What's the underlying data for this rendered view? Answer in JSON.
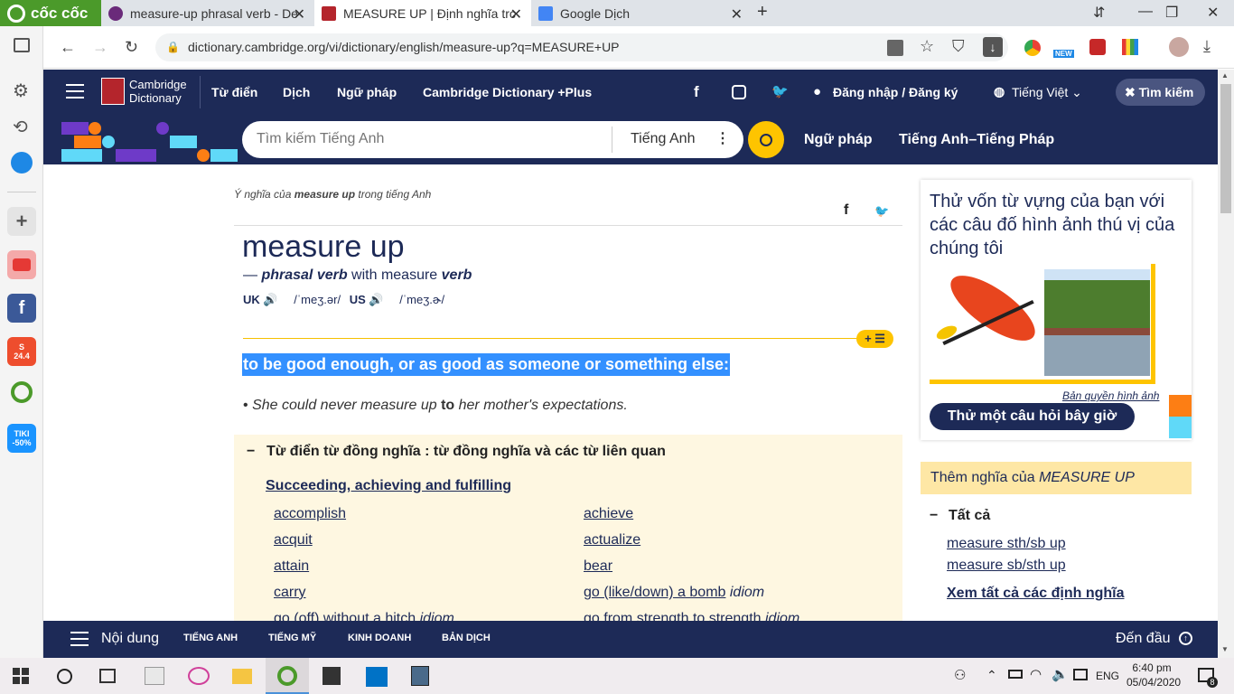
{
  "browser": {
    "brand": "cốc cốc",
    "tabs": [
      {
        "title": "measure-up phrasal verb - De",
        "icon_color": "#6a2a7a"
      },
      {
        "title": "MEASURE UP | Định nghĩa trc",
        "icon_color": "#b4252c"
      },
      {
        "title": "Google Dịch",
        "icon_color": "#4285f4"
      }
    ],
    "url": "dictionary.cambridge.org/vi/dictionary/english/measure-up?q=MEASURE+UP",
    "new_badge": "NEW"
  },
  "sidebar": {
    "icons": [
      "settings-icon",
      "history-icon",
      "messenger-icon",
      "add-icon",
      "youtube-icon",
      "facebook-icon",
      "shopee-icon",
      "coccoc-icon",
      "tiki-icon"
    ],
    "shopee_label": "24.4",
    "tiki_label": "TIKI -50%"
  },
  "header": {
    "logo_line1": "Cambridge",
    "logo_line2": "Dictionary",
    "nav": [
      "Từ điển",
      "Dịch",
      "Ngữ pháp",
      "Cambridge Dictionary +Plus"
    ],
    "login": "Đăng nhập / Đăng ký",
    "language": "Tiếng Việt",
    "search_toggle": "Tìm kiếm",
    "search_placeholder": "Tìm kiếm Tiếng Anh",
    "search_lang": "Tiếng Anh",
    "sub_nav": [
      "Ngữ pháp",
      "Tiếng Anh–Tiếng Pháp"
    ]
  },
  "entry": {
    "breadcrumb_pre": "Ý nghĩa của ",
    "breadcrumb_word": "measure up",
    "breadcrumb_post": " trong tiếng Anh",
    "headword": "measure up",
    "pos_dash": "— ",
    "pos": "phrasal verb",
    "with": " with measure ",
    "with_pos": "verb",
    "uk": "UK",
    "uk_ipa": "/ˈmeʒ.ər/",
    "us": "US",
    "us_ipa": "/ˈmeʒ.ɚ/",
    "definition": "to be good enough, or as good as someone or something else:",
    "example_pre": "She could never measure up ",
    "example_bold": "to",
    "example_post": " her mother's expectations.",
    "add_button": "+"
  },
  "synonyms": {
    "heading": "Từ điển từ đồng nghĩa : từ đồng nghĩa và các từ liên quan",
    "group": "Succeeding, achieving and fulfilling",
    "left": [
      "accomplish",
      "acquit",
      "attain",
      "carry"
    ],
    "right": [
      "achieve",
      "actualize",
      "bear",
      "go (like/down) a bomb"
    ],
    "right_idiom_index": 3,
    "idiom_label": "idiom",
    "partial_left": "go (off) without a hitch",
    "partial_right": "go from strength to strength"
  },
  "promo": {
    "text": "Thử vốn từ vựng của bạn với các câu đố hình ảnh thú vị của chúng tôi",
    "copyright": "Bản quyền hình ảnh",
    "button": "Thử một câu hỏi bây giờ"
  },
  "more": {
    "title_pre": "Thêm nghĩa của ",
    "title_word": "MEASURE UP",
    "all": "Tất cả",
    "links": [
      "measure sth/sb up",
      "measure sb/sth up"
    ],
    "see_all": "Xem tất cả các định nghĩa"
  },
  "bottom_bar": {
    "contents": "Nội dung",
    "items": [
      "TIẾNG ANH",
      "TIẾNG MỸ",
      "KINH DOANH",
      "BẢN DỊCH"
    ],
    "to_top": "Đến đầu"
  },
  "taskbar": {
    "lang": "ENG",
    "time": "6:40 pm",
    "date": "05/04/2020",
    "notif": "8"
  }
}
